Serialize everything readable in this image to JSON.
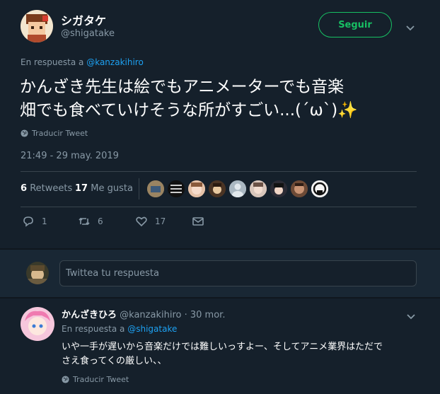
{
  "tweet": {
    "author_name": "シガタケ",
    "author_handle": "@shigatake",
    "follow_label": "Seguir",
    "reply_prefix": "En respuesta a",
    "reply_to": "@kanzakihiro",
    "text_line1": "かんざき先生は絵でもアニメーターでも音楽",
    "text_line2": "畑でも食べていけそうな所がすごい...(´ω`)✨",
    "translate_label": "Traducir Tweet",
    "timestamp": "21:49 - 29 may. 2019",
    "retweets_count": "6",
    "retweets_label": "Retweets",
    "likes_count": "17",
    "likes_label": "Me gusta",
    "actions": {
      "reply": "1",
      "retweet": "6",
      "like": "17"
    }
  },
  "composer": {
    "placeholder": "Twittea tu respuesta"
  },
  "reply": {
    "author_name": "かんざきひろ",
    "author_handle": "@kanzakihiro",
    "date": "· 30 mor.",
    "reply_prefix": "En respuesta a",
    "reply_to": "@shigatake",
    "text_line1": "いや一手が遅いから音楽だけでは難しいっすよー、そしてアニメ業界はただで",
    "text_line2": "さえ食ってくの厳しい、、",
    "translate_label": "Traducir Tweet"
  },
  "colors": {
    "background": "#15202b",
    "accent": "#1da1f2",
    "follow_green": "#17bf63",
    "muted": "#8899a6",
    "divider": "#38444d"
  },
  "icons": [
    "globe-icon",
    "chevron-down-icon",
    "reply-icon",
    "retweet-icon",
    "heart-icon",
    "mail-icon"
  ]
}
